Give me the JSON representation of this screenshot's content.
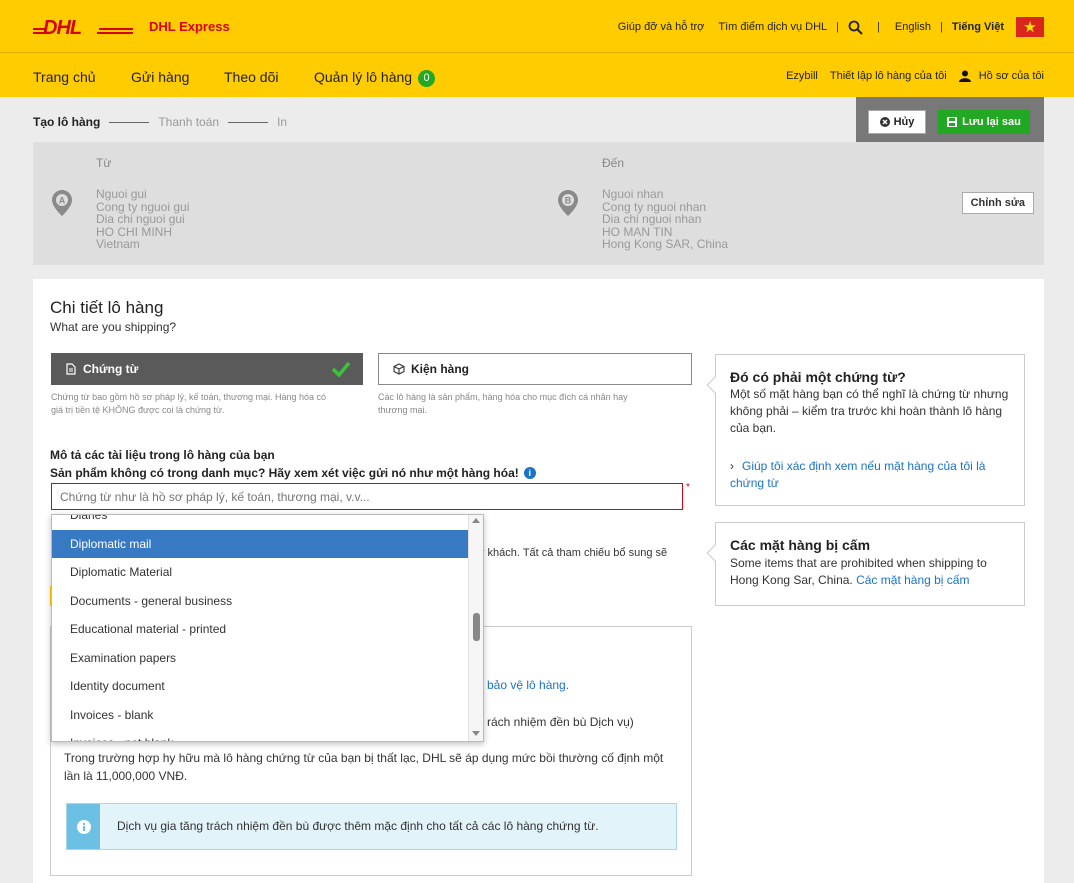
{
  "header": {
    "brand": "DHL Express",
    "help": "Giúp đỡ và hỗ trợ",
    "find_service": "Tìm điểm dịch vụ DHL",
    "lang_en": "English",
    "lang_vi": "Tiếng Việt"
  },
  "nav": {
    "home": "Trang chủ",
    "send": "Gửi hàng",
    "track": "Theo dõi",
    "manage": "Quản lý lô hàng",
    "manage_count": "0",
    "ezybill": "Ezybill",
    "setup": "Thiết lập lô hàng của tôi",
    "profile": "Hồ sơ của tôi"
  },
  "steps": {
    "create": "Tạo lô hàng",
    "pay": "Thanh toán",
    "print": "In"
  },
  "actions": {
    "cancel": "Hủy",
    "save": "Lưu lại sau"
  },
  "address": {
    "from_label": "Từ",
    "to_label": "Đến",
    "from": {
      "name": "Nguoi gui",
      "company": "Cong ty nguoi gui",
      "street": "Dia chi nguoi gui",
      "city": "HO CHI MINH",
      "country": "Vietnam"
    },
    "to": {
      "name": "Nguoi nhan",
      "company": "Cong ty nguoi nhan",
      "street": "Dia chi nguoi nhan",
      "city": "HO MAN TIN",
      "country": "Hong Kong SAR, China"
    },
    "edit": "Chỉnh sửa"
  },
  "details": {
    "title": "Chi tiết lô hàng",
    "subtitle": "What are you shipping?",
    "documents_tile": "Chứng từ",
    "documents_desc_1": "Chứng từ bao gồm hồ sơ pháp lý, kế toán, thương mại. Hàng hóa có",
    "documents_desc_2": "giá trị tiền tệ KHÔNG được coi là chứng từ.",
    "package_tile": "Kiện hàng",
    "package_desc_1": "Các lô hàng là sản phẩm, hàng hóa cho mục đích cá nhân hay",
    "package_desc_2": "thương mại.",
    "describe_label": "Mô tả các tài liệu trong lô hàng của bạn",
    "not_listed": "Sản phẩm không có trong danh mục? Hãy xem xét việc gửi nó như một hàng hóa!",
    "input_placeholder": "Chứng từ như là hồ sơ pháp lý, kế toán, thương mại, v.v...",
    "behind_text": "ý khách. Tất cả tham chiếu bổ sung sẽ",
    "protect_link": "bảo vệ lô hàng.",
    "liability_text": "rách nhiệm đền bù Dịch vụ)",
    "compensation": "Trong trường hợp hy hữu mà lô hàng chứng từ của bạn bị thất lạc, DHL sẽ áp dụng mức bồi thường cố định một lần là 11,000,000 VNĐ.",
    "notice": "Dịch vụ gia tăng trách nhiệm đền bù được thêm mặc định cho tất cả các lô hàng chứng từ."
  },
  "side": {
    "doc_title": "Đó có phải một chứng từ?",
    "doc_text": "Một số mặt hàng bạn có thể nghĩ là chứng từ nhưng không phải – kiểm tra trước khi hoàn thành lô hàng của bạn.",
    "doc_link": "Giúp tôi xác định xem nếu mặt hàng của tôi là chứng từ",
    "prohibited_title": "Các mặt hàng bị cấm",
    "prohibited_text": "Some items that are prohibited when shipping to Hong Kong Sar, China.",
    "prohibited_link": "Các mặt hàng bị cấm"
  },
  "dropdown": {
    "items": [
      "Diaries",
      "Diplomatic mail",
      "Diplomatic Material",
      "Documents - general business",
      "Educational material - printed",
      "Examination papers",
      "Identity document",
      "Invoices - blank",
      "Invoices - not blank"
    ],
    "selected": "Diplomatic mail"
  },
  "colors": {
    "dhl_yellow": "#fecc00",
    "dhl_red": "#d40511",
    "green": "#22a822",
    "selected_blue": "#3879c4",
    "link_blue": "#1a73c8"
  }
}
